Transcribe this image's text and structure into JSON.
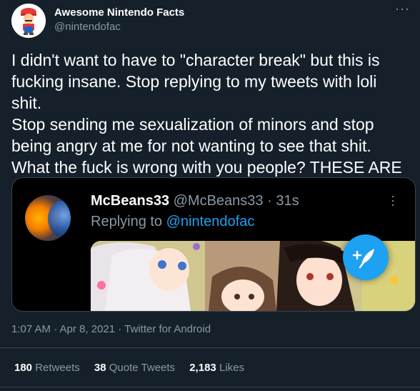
{
  "author": {
    "display_name": "Awesome Nintendo Facts",
    "handle": "@nintendofac",
    "avatar_icon": "mario-avatar-icon"
  },
  "tweet": {
    "text": "I didn't want to have to \"character break\" but this is\nfucking insane. Stop replying to my tweets with loli shit.\nStop sending me sexualization of minors and stop\nbeing angry at me for not wanting to see that shit.\nWhat the fuck is wrong with you people? THESE ARE\nCHILDREN"
  },
  "embedded": {
    "name": "McBeans33",
    "handle": "@McBeans33",
    "separator": "·",
    "time": "31s",
    "reply_prefix": "Replying to",
    "reply_to": "@nintendofac",
    "avatar_icon": "planet-avatar-icon",
    "image_icon": "anime-characters-image"
  },
  "compose_icon": "compose-feather-icon",
  "meta": {
    "text": "1:07 AM · Apr 8, 2021 · Twitter for Android"
  },
  "stats": [
    {
      "count": "180",
      "label": "Retweets"
    },
    {
      "count": "38",
      "label": "Quote Tweets"
    },
    {
      "count": "2,183",
      "label": "Likes"
    }
  ],
  "colors": {
    "background": "#15202b",
    "accent": "#1da1f2",
    "secondary_text": "#8899a6",
    "divider": "#38444d"
  }
}
